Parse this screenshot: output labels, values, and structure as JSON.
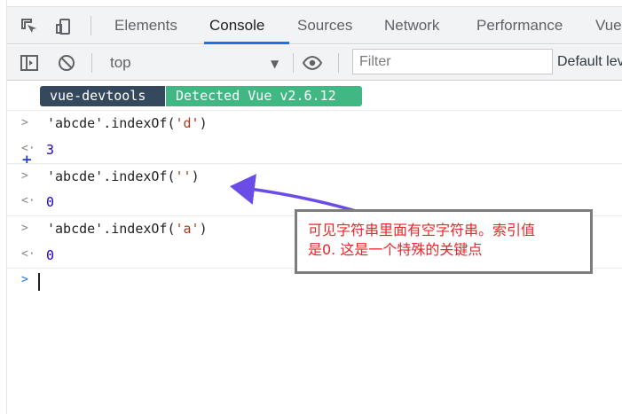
{
  "tabs": [
    "Elements",
    "Console",
    "Sources",
    "Network",
    "Performance",
    "Vue"
  ],
  "active_tab": "Console",
  "toolbar": {
    "context": "top",
    "filter_placeholder": "Filter",
    "levels_label": "Default levels"
  },
  "banner": {
    "left": "vue-devtools",
    "right": "Detected Vue v2.6.12"
  },
  "console_entries": [
    {
      "input_prefix": "'abcde'.indexOf(",
      "input_arg": "'d'",
      "input_suffix": ")",
      "result": "3"
    },
    {
      "input_prefix": "'abcde'.indexOf(",
      "input_arg": "''",
      "input_suffix": ")",
      "result": "0"
    },
    {
      "input_prefix": "'abcde'.indexOf(",
      "input_arg": "'a'",
      "input_suffix": ")",
      "result": "0"
    }
  ],
  "annotation": {
    "line1": "可见字符串里面有空字符串。索引值",
    "line2": "是0. 这是一个特殊的关键点",
    "text_color": "#e8262b",
    "arrow_color": "#6b4ce6"
  },
  "icons": {
    "inspect": "inspect-element-icon",
    "device": "device-toolbar-icon",
    "sidebar": "show-sidebar-icon",
    "clear": "clear-console-icon",
    "eye": "live-expression-eye-icon",
    "plus": "add-marker-icon"
  },
  "colors": {
    "tab_underline": "#1a73e8",
    "vue_dark": "#35495e",
    "vue_green": "#41b883",
    "string": "#a53a1e",
    "number": "#1c00cf"
  }
}
